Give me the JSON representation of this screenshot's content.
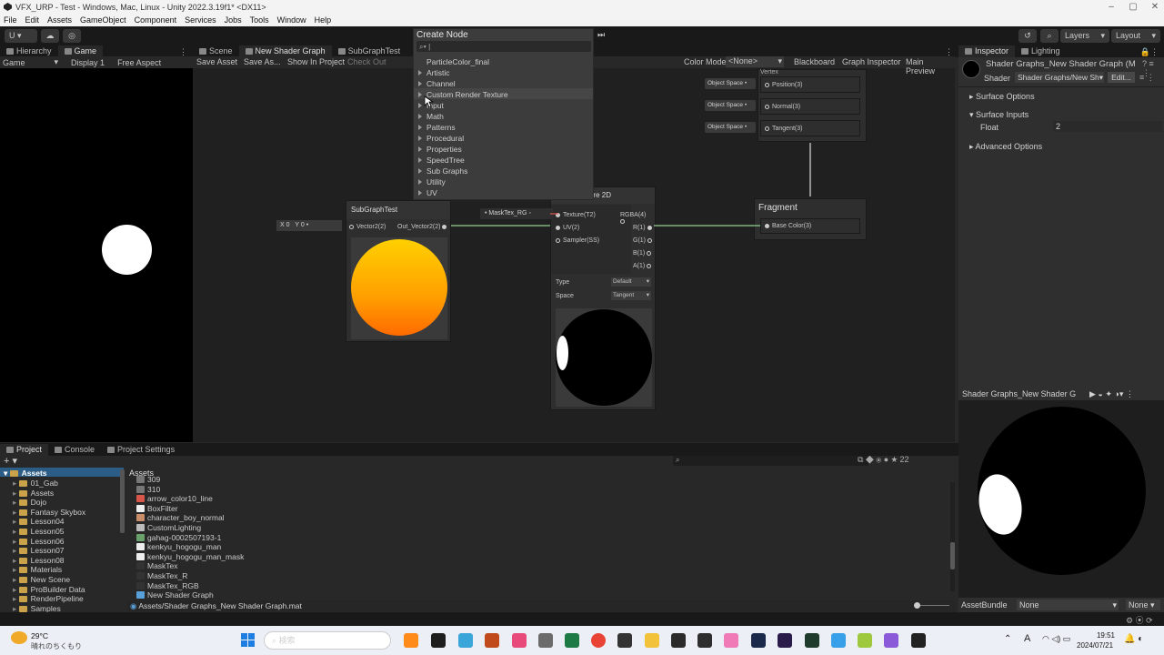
{
  "window": {
    "title": "VFX_URP - Test - Windows, Mac, Linux - Unity 2022.3.19f1* <DX11>"
  },
  "menu": [
    "File",
    "Edit",
    "Assets",
    "GameObject",
    "Component",
    "Services",
    "Jobs",
    "Tools",
    "Window",
    "Help"
  ],
  "toolbar": {
    "account": "U",
    "layers": "Layers",
    "layout": "Layout"
  },
  "left_tabs": [
    "Hierarchy",
    "Game"
  ],
  "game_bar": {
    "display": "Game",
    "display_num": "Display 1",
    "aspect": "Free Aspect"
  },
  "graph_tabs": [
    "Scene",
    "New Shader Graph",
    "SubGraphTest"
  ],
  "graph_bar": {
    "save": "Save Asset",
    "save_as": "Save As...",
    "show": "Show In Project",
    "checkout": "Check Out",
    "color_mode_label": "Color Mode",
    "color_mode": "<None>",
    "blackboard": "Blackboard",
    "graph_inspector": "Graph Inspector",
    "main_preview": "Main Preview"
  },
  "create_node": {
    "title": "Create Node",
    "items": [
      "ParticleColor_final",
      "Artistic",
      "Channel",
      "Custom Render Texture",
      "Input",
      "Math",
      "Patterns",
      "Procedural",
      "Properties",
      "SpeedTree",
      "Sub Graphs",
      "Utility",
      "UV"
    ]
  },
  "vertex": {
    "title": "Vertex",
    "ports": [
      {
        "space": "Object Space",
        "name": "Position(3)"
      },
      {
        "space": "Object Space",
        "name": "Normal(3)"
      },
      {
        "space": "Object Space",
        "name": "Tangent(3)"
      }
    ]
  },
  "fragment": {
    "title": "Fragment",
    "port": "Base Color(3)"
  },
  "subgraph_node": {
    "title": "SubGraphTest",
    "in": "Vector2(2)",
    "out": "Out_Vector2(2)",
    "x_label": "X",
    "x": "0",
    "y_label": "Y",
    "y": "0"
  },
  "sample_node": {
    "title": "ure 2D",
    "mask_prop": "MaskTex_RG",
    "inputs": [
      "Texture(T2)",
      "UV(2)",
      "Sampler(SS)"
    ],
    "outputs": [
      "RGBA(4)",
      "R(1)",
      "G(1)",
      "B(1)",
      "A(1)"
    ],
    "type_label": "Type",
    "type": "Default",
    "space_label": "Space",
    "space": "Tangent"
  },
  "inspector": {
    "tabs": [
      "Inspector",
      "Lighting"
    ],
    "material": "Shader Graphs_New Shader Graph (Ma",
    "shader_label": "Shader",
    "shader": "Shader Graphs/New Sh",
    "edit": "Edit...",
    "surface_options": "Surface Options",
    "surface_inputs": "Surface Inputs",
    "float_label": "Float",
    "float_value": "2",
    "advanced": "Advanced Options",
    "preview_title": "Shader Graphs_New Shader G",
    "asset_bundle": "AssetBundle",
    "bundle": "None",
    "variant": "None"
  },
  "bottom_tabs": [
    "Project",
    "Console",
    "Project Settings"
  ],
  "project": {
    "tree_root": "Assets",
    "tree": [
      "01_Gab",
      "Assets",
      "Dojo",
      "Fantasy Skybox",
      "Lesson04",
      "Lesson05",
      "Lesson06",
      "Lesson07",
      "Lesson08",
      "Materials",
      "New Scene",
      "ProBuilder Data",
      "RenderPipeline",
      "Samples"
    ],
    "header": "Assets",
    "files": [
      "309",
      "310",
      "arrow_color10_line",
      "BoxFilter",
      "character_boy_normal",
      "CustomLighting",
      "gahag-0002507193-1",
      "kenkyu_hogogu_man",
      "kenkyu_hogogu_man_mask",
      "MaskTex",
      "MaskTex_R",
      "MaskTex_RGB",
      "New Shader Graph"
    ],
    "path": "Assets/Shader Graphs_New Shader Graph.mat",
    "count": "22"
  },
  "taskbar": {
    "temp": "29°C",
    "weather": "晴れのちくもり",
    "search": "検索",
    "time": "19:51",
    "date": "2024/07/21",
    "ime": "A"
  }
}
